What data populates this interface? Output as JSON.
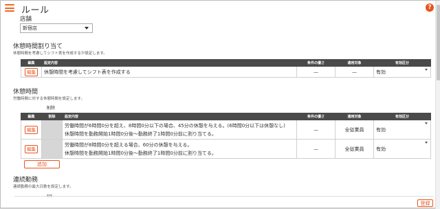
{
  "header": {
    "title": "ルール"
  },
  "store": {
    "label": "店舗",
    "value": "新宿店"
  },
  "section1": {
    "title": "休憩時間割り当て",
    "description": "休憩時間を考慮してシフト表を作成するか設定します。",
    "columns": [
      "編集",
      "設定内容",
      "条件の優さ",
      "適用対象",
      "有効区分"
    ],
    "rows": [
      {
        "edit": "編集",
        "content": "休憩時間を考慮してシフト表を作成する",
        "condition": "—",
        "target": "—",
        "status": "有効"
      }
    ]
  },
  "section2": {
    "title": "休憩時間",
    "description": "労働時間に対する休憩時間を設定します。",
    "delete_label": "削除",
    "columns": [
      "編集",
      "削除",
      "設定内容",
      "条件の優さ",
      "適用対象",
      "有効区分"
    ],
    "rows": [
      {
        "edit": "編集",
        "line1": "労働時間が6時間0分を超え、8時間0分以下の場合、45分の休憩を与える。(6時間0分以下は休憩なし)",
        "line2": "休憩時間を勤務開始1時間0分後〜勤務終了1時間0分前に割り当てる。",
        "condition": "—",
        "target": "全従業員",
        "status": "有効"
      },
      {
        "edit": "編集",
        "line1": "労働時間が8時間0分を超える場合、60分の休憩を与える。",
        "line2": "休憩時間を勤務開始1時間0分後〜勤務終了1時間0分前に割り当てる。",
        "condition": "—",
        "target": "全従業員",
        "status": "有効"
      }
    ],
    "add_label": "追加"
  },
  "section3": {
    "title": "連続勤務",
    "description": "連続勤務の最大日数を設定します。",
    "delete_label": "削除"
  },
  "footer": {
    "save_label": "登録"
  },
  "colors": {
    "accent": "#e8541e",
    "header_bg": "#4a4a4a"
  }
}
